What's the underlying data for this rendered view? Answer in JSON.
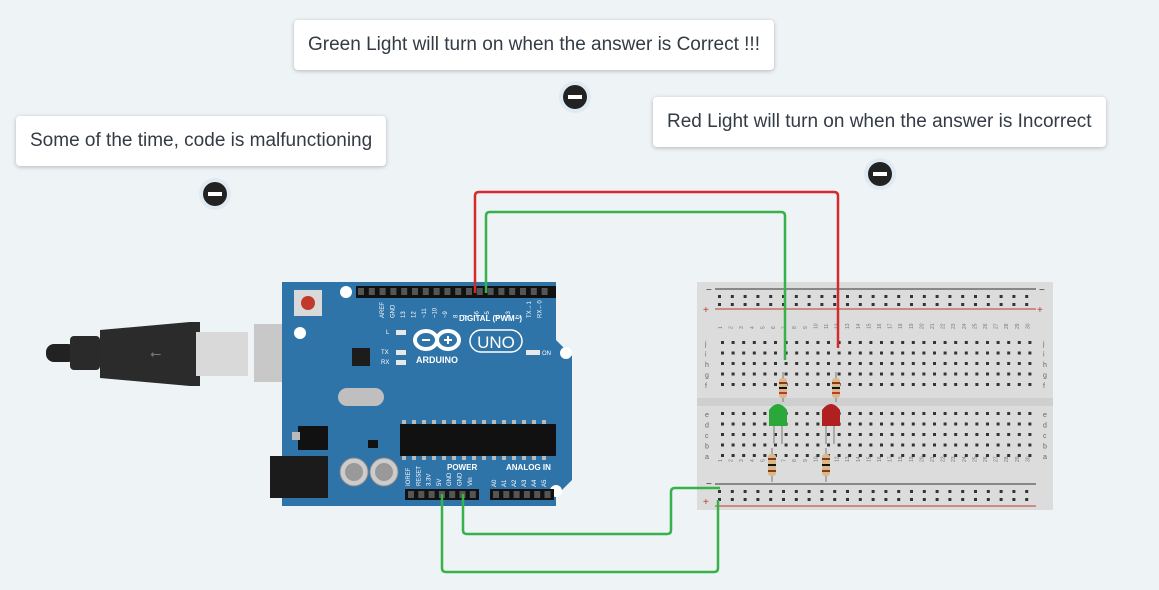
{
  "annotations": [
    {
      "id": "green",
      "text": "Green Light will turn on when the answer is Correct !!!"
    },
    {
      "id": "malfunction",
      "text": "Some of the time, code is malfunctioning"
    },
    {
      "id": "red",
      "text": "Red Light will turn on when the answer is Incorrect"
    }
  ],
  "arduino": {
    "brand": "ARDUINO",
    "model": "UNO",
    "digital_label": "DIGITAL (PWM~)",
    "power_label": "POWER",
    "analog_label": "ANALOG IN",
    "on_label": "ON",
    "l_label": "L",
    "tx_label": "TX",
    "rx_label": "RX",
    "digital_pins": [
      "AREF",
      "GND",
      "13",
      "12",
      "~11",
      "~10",
      "~9",
      "8",
      "7",
      "~6",
      "~5",
      "4",
      "~3",
      "2",
      "TX→1",
      "RX←0"
    ],
    "power_pins": [
      "IOREF",
      "RESET",
      "3.3V",
      "5V",
      "GND",
      "GND",
      "Vin"
    ],
    "analog_pins": [
      "A0",
      "A1",
      "A2",
      "A3",
      "A4",
      "A5"
    ]
  },
  "breadboard": {
    "row_letters_top": [
      "a",
      "b",
      "c",
      "d",
      "e"
    ],
    "row_letters_bottom": [
      "f",
      "g",
      "h",
      "i",
      "j"
    ],
    "column_count": 30
  },
  "colors": {
    "board": "#2f74a8",
    "wire_red": "#d42a2a",
    "wire_green": "#36b24a",
    "led_green": "#2aa83a",
    "led_red": "#b02020",
    "background": "#eef3f6"
  }
}
